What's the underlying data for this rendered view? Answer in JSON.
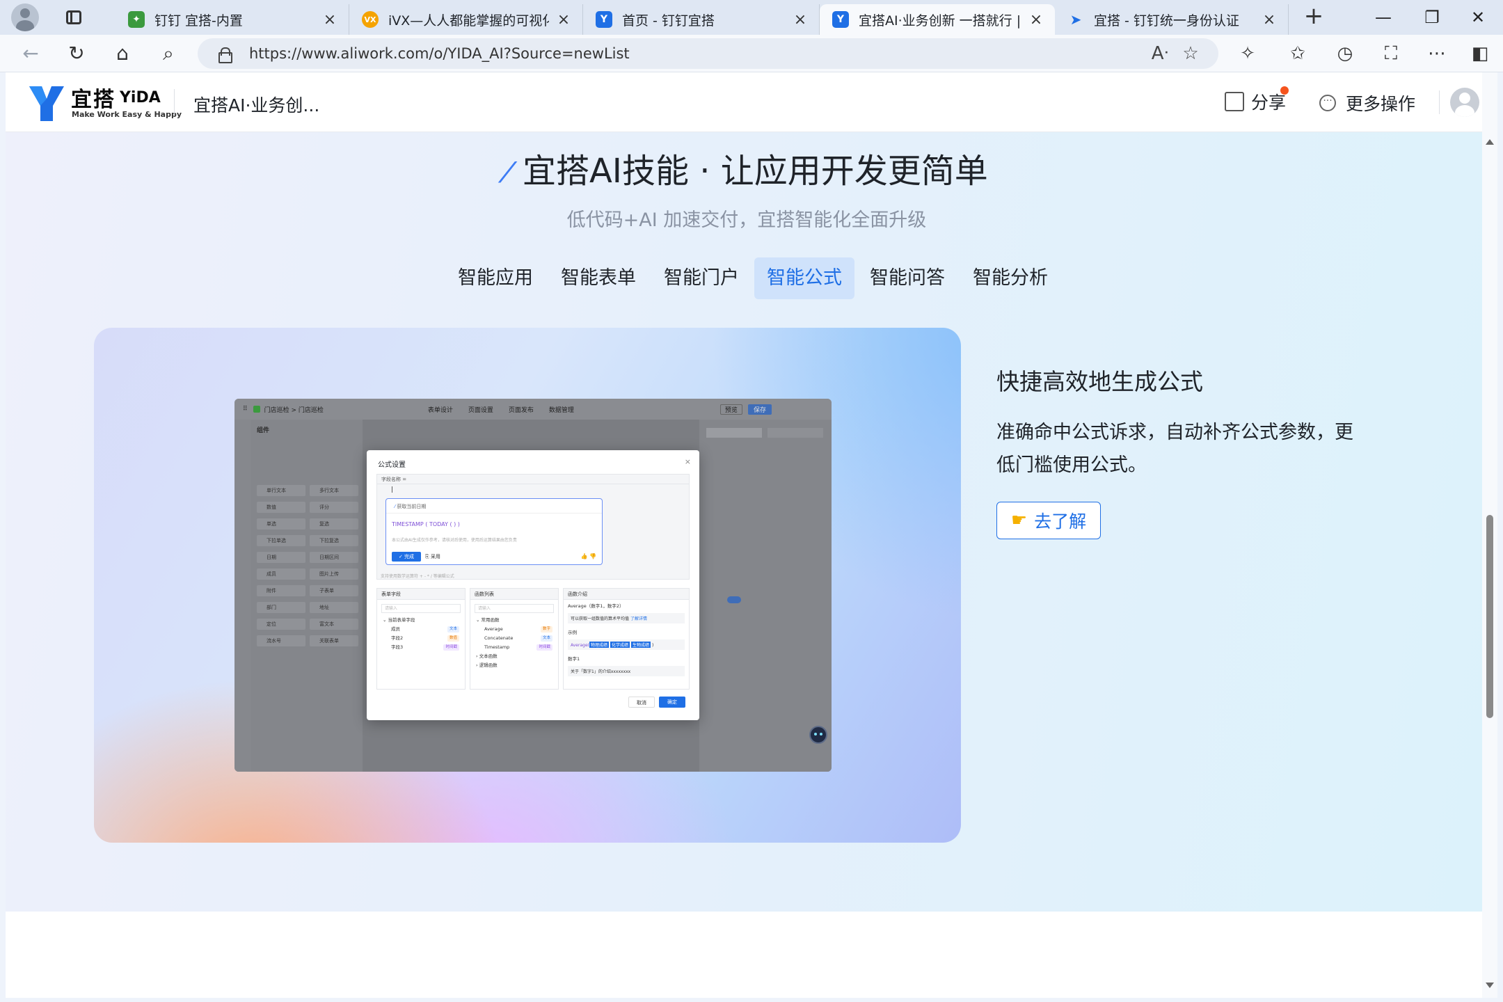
{
  "browser": {
    "tabs": [
      {
        "title": "钉钉 宜搭-内置",
        "fav_color": "#3b9a3e",
        "fav_char": "✦"
      },
      {
        "title": "iVX—人人都能掌握的可视化编",
        "fav_color": "#f5a300",
        "fav_char": "VX"
      },
      {
        "title": "首页 - 钉钉宜搭",
        "fav_color": "#1f6fe5",
        "fav_char": "Y"
      },
      {
        "title": "宜搭AI·业务创新 一搭就行 | 宜",
        "fav_color": "#1f6fe5",
        "fav_char": "Y",
        "active": true
      },
      {
        "title": "宜搭 - 钉钉统一身份认证",
        "fav_color": "#1f6fe5",
        "fav_char": "➤"
      }
    ],
    "url": "https://www.aliwork.com/o/YIDA_AI?Source=newList"
  },
  "header": {
    "logo_cn": "宜搭",
    "logo_en": "YiDA",
    "logo_slogan": "Make Work Easy & Happy",
    "app_name": "宜搭AI·业务创...",
    "share_label": "分享",
    "more_label": "更多操作"
  },
  "section": {
    "title": "宜搭AI技能 · 让应用开发更简单",
    "subtitle": "低代码+AI 加速交付，宜搭智能化全面升级",
    "tabs": [
      "智能应用",
      "智能表单",
      "智能门户",
      "智能公式",
      "智能问答",
      "智能分析"
    ],
    "active_tab": 3
  },
  "feature": {
    "title": "快捷高效地生成公式",
    "desc": "准确命中公式诉求，自动补齐公式参数，更低门槛使用公式。",
    "button_label": "去了解"
  },
  "preview": {
    "breadcrumb": "门店巡检 > 门店巡检",
    "top_tabs": [
      "表单设计",
      "页面设置",
      "页面发布",
      "数据管理"
    ],
    "btn_preview": "预览",
    "btn_save": "保存",
    "panel_title": "组件",
    "components": [
      "单行文本",
      "多行文本",
      "数值",
      "评分",
      "单选",
      "复选",
      "下拉单选",
      "下拉复选",
      "日期",
      "日期区间",
      "成员",
      "图片上传",
      "附件",
      "子表单",
      "部门",
      "地址",
      "定位",
      "富文本",
      "流水号",
      "关联表单"
    ],
    "dialog_title": "公式设置",
    "field_label": "字段名称 =",
    "ai_question": "获取当前日期",
    "ai_formula": "TIMESTAMP ( TODAY ( ) )",
    "ai_hint": "本公式由AI生成仅作参考，请核对后使用，使用后运算结果由您负责",
    "ai_ok": "完成",
    "ai_apply": "采用",
    "editor_hint": "支持使用数学运算符 + - * / 等编辑公式",
    "col1_title": "表单字段",
    "col1_search": "请输入",
    "col1_group": "当前表单字段",
    "col1_rows": [
      {
        "name": "成员",
        "tag": "文本",
        "tone": ""
      },
      {
        "name": "字段2",
        "tag": "数值",
        "tone": "o"
      },
      {
        "name": "字段3",
        "tag": "时间戳",
        "tone": "p"
      }
    ],
    "col2_title": "函数列表",
    "col2_search": "请输入",
    "col2_group": "常用函数",
    "col2_rows": [
      {
        "name": "Average",
        "tag": "数字",
        "tone": "o"
      },
      {
        "name": "Concatenate",
        "tag": "文本",
        "tone": ""
      },
      {
        "name": "Timestamp",
        "tag": "时间戳",
        "tone": "p"
      }
    ],
    "col2_more": [
      "文本函数",
      "逻辑函数"
    ],
    "col3_title": "函数介绍",
    "col3_sig": "Average（数字1，数字2）",
    "col3_desc": "可以获取一组数值的算术平均值",
    "col3_link": "了解详情",
    "col3_example_label": "示例",
    "col3_example_fn": "Average(",
    "col3_example_tokens": [
      "物理成绩",
      "化学成绩",
      "生物成绩"
    ],
    "col3_param_label": "数字1",
    "col3_param_desc": "关于「数字1」的介绍xxxxxxxx",
    "btn_cancel": "取消",
    "btn_confirm": "确定"
  }
}
